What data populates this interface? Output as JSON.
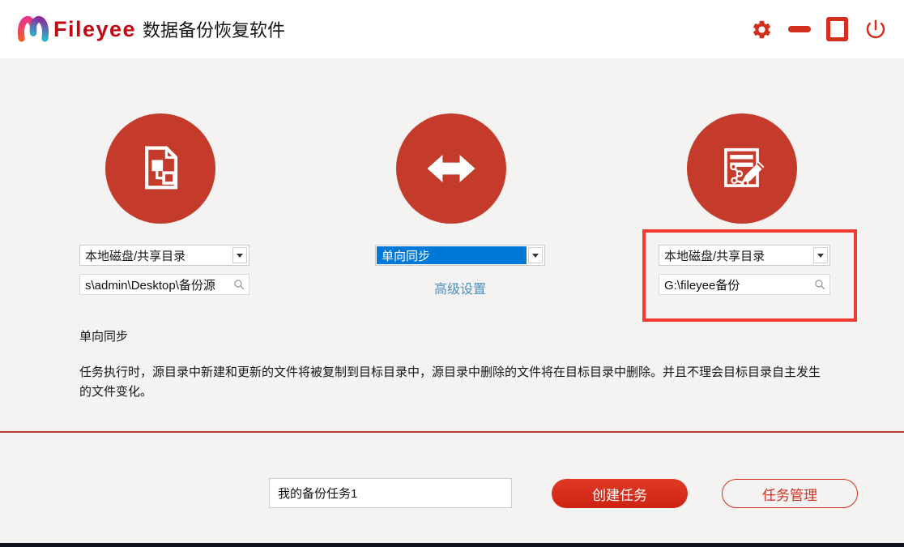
{
  "window": {
    "brand": "Fileyee",
    "title": "数据备份恢复软件"
  },
  "source_panel": {
    "type_value": "本地磁盘/共享目录",
    "path_value": "s\\admin\\Desktop\\备份源"
  },
  "mode_panel": {
    "mode_value": "单向同步",
    "advanced_link": "高级设置"
  },
  "target_panel": {
    "type_value": "本地磁盘/共享目录",
    "path_value": "G:\\fileyee备份"
  },
  "info": {
    "heading": "单向同步",
    "description": "任务执行时，源目录中新建和更新的文件将被复制到目标目录中，源目录中删除的文件将在目标目录中删除。并且不理会目标目录自主发生的文件变化。"
  },
  "footer": {
    "task_name_value": "我的备份任务1",
    "create_task_label": "创建任务",
    "task_manager_label": "任务管理"
  },
  "icons": {
    "window": [
      "settings-gear-icon",
      "minimize-icon",
      "maximize-icon",
      "power-close-icon"
    ],
    "panels": [
      "source-document-icon",
      "two-way-arrow-icon",
      "edit-target-icon"
    ],
    "inputs": "search-icon"
  },
  "colors": {
    "accent_red": "#d2301f",
    "circle_red": "#c43b2b",
    "highlight_red": "#f43b31",
    "selection_blue": "#0078d7",
    "link_blue": "#4a8fc0",
    "page_bg": "#f4f3f2",
    "header_bg": "#ffffff"
  }
}
